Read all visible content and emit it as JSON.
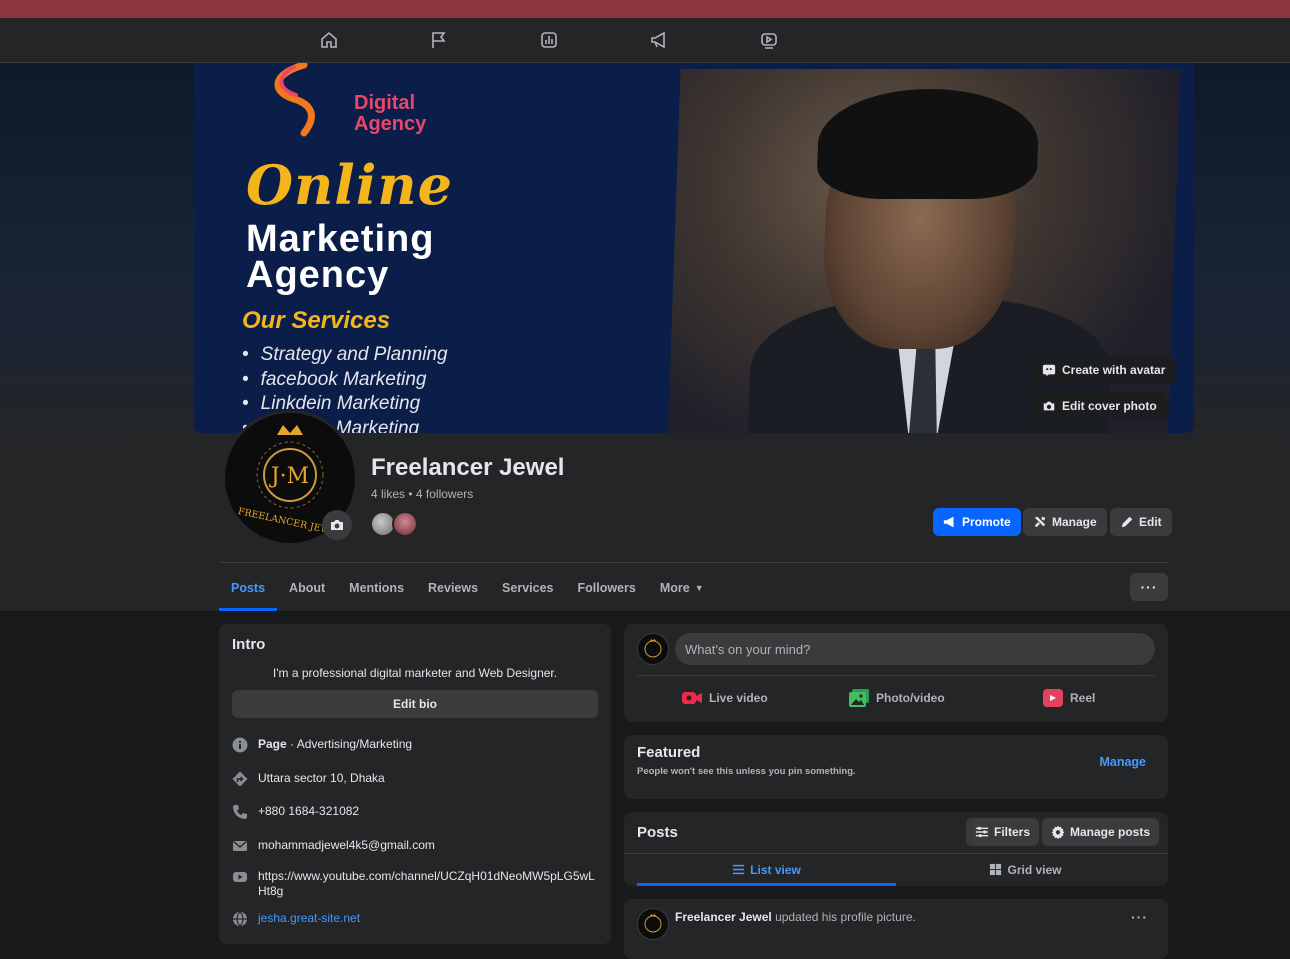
{
  "nav": {
    "icons": [
      "home-icon",
      "flag-icon",
      "insights-icon",
      "megaphone-icon",
      "video-icon"
    ]
  },
  "cover": {
    "brand_line1": "Digital",
    "brand_line2": "Agency",
    "headline": "Online",
    "subheadline_line1": "Marketing",
    "subheadline_line2": "Agency",
    "services_title": "Our Services",
    "services": [
      "Strategy and Planning",
      "facebook Marketing",
      "Linkdein Marketing",
      "Youtube Marketing"
    ],
    "create_avatar_label": "Create with avatar",
    "edit_cover_label": "Edit cover photo"
  },
  "profile": {
    "name": "Freelancer Jewel",
    "stats": "4 likes • 4 followers",
    "avatar_text": "J·M",
    "avatar_subtext": "FREELANCER JEWEL"
  },
  "actions": {
    "promote": "Promote",
    "manage": "Manage",
    "edit": "Edit"
  },
  "tabs": [
    "Posts",
    "About",
    "Mentions",
    "Reviews",
    "Services",
    "Followers",
    "More"
  ],
  "more_button": "···",
  "intro": {
    "title": "Intro",
    "bio": "I'm a professional digital marketer and Web Designer.",
    "edit_bio": "Edit bio",
    "category_bold": "Page",
    "category": " · Advertising/Marketing",
    "address": "Uttara sector 10, Dhaka",
    "phone": "+880 1684-321082",
    "email": "mohammadjewel4k5@gmail.com",
    "youtube": "https://www.youtube.com/channel/UCZqH01dNeoMW5pLG5wLHt8g",
    "website": "jesha.great-site.net"
  },
  "composer": {
    "placeholder": "What's on your mind?",
    "live": "Live video",
    "photo": "Photo/video",
    "reel": "Reel"
  },
  "featured": {
    "title": "Featured",
    "subtitle": "People won't see this unless you pin something.",
    "manage": "Manage"
  },
  "posts": {
    "title": "Posts",
    "filters": "Filters",
    "manage_posts": "Manage posts",
    "list_view": "List view",
    "grid_view": "Grid view"
  },
  "feed": {
    "author": "Freelancer Jewel",
    "action": " updated his profile picture."
  },
  "colors": {
    "accent": "#0866ff",
    "link": "#4599ff",
    "topstrip": "#8a3540",
    "gold": "#f4b41c"
  }
}
